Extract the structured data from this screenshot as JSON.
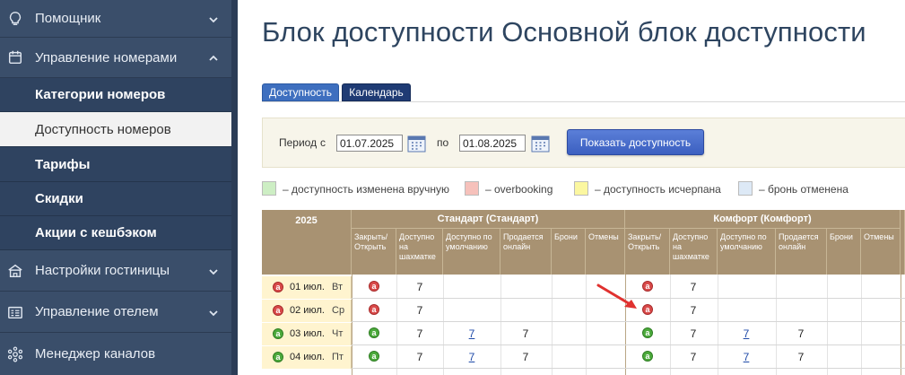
{
  "sidebar": {
    "items": [
      {
        "label": "Помощник",
        "icon": "lightbulb-icon",
        "expanded": false
      },
      {
        "label": "Управление номерами",
        "icon": "calendar-icon",
        "expanded": true
      },
      {
        "label": "Настройки гостиницы",
        "icon": "building-icon",
        "expanded": false
      },
      {
        "label": "Управление отелем",
        "icon": "dashboard-icon",
        "expanded": false
      },
      {
        "label": "Менеджер каналов",
        "icon": "network-icon",
        "expanded": false
      }
    ],
    "subitems": [
      {
        "label": "Категории номеров",
        "active": false
      },
      {
        "label": "Доступность номеров",
        "active": true
      },
      {
        "label": "Тарифы",
        "active": false
      },
      {
        "label": "Скидки",
        "active": false
      },
      {
        "label": "Акции с кешбэком",
        "active": false
      }
    ]
  },
  "page": {
    "title": "Блок доступности Основной блок доступности"
  },
  "tabs": [
    {
      "label": "Доступность",
      "active": true
    },
    {
      "label": "Календарь",
      "active": false
    }
  ],
  "filter": {
    "period_label": "Период",
    "from_label": "с",
    "from_value": "01.07.2025",
    "to_label": "по",
    "to_value": "01.08.2025",
    "show_button": "Показать доступность"
  },
  "legend": [
    {
      "color": "#cdeec4",
      "text": "– доступность изменена вручную"
    },
    {
      "color": "#f6c1bb",
      "text": "– overbooking"
    },
    {
      "color": "#fbf7a0",
      "text": "– доступность исчерпана"
    },
    {
      "color": "#dde9f6",
      "text": "– бронь отменена"
    }
  ],
  "grid": {
    "year": "2025",
    "groups": [
      "Стандарт (Стандарт)",
      "Комфорт (Комфорт)"
    ],
    "columns": [
      "Закрыть/ Открыть",
      "Доступно на шахматке",
      "Доступно по умолчанию",
      "Продается онлайн",
      "Брони",
      "Отмены"
    ],
    "rows": [
      {
        "status": "a",
        "status_color": "red",
        "day": "01 июл.",
        "weekday": "Вт",
        "standard": {
          "toggle": "a",
          "toggle_color": "red",
          "avail": "7",
          "default": "",
          "online": "",
          "bookings": "",
          "cancels": ""
        },
        "comfort": {
          "toggle": "a",
          "toggle_color": "red",
          "avail": "7",
          "default": "",
          "online": "",
          "bookings": "",
          "cancels": ""
        }
      },
      {
        "status": "a",
        "status_color": "red",
        "day": "02 июл.",
        "weekday": "Ср",
        "standard": {
          "toggle": "a",
          "toggle_color": "red",
          "avail": "7",
          "default": "",
          "online": "",
          "bookings": "",
          "cancels": ""
        },
        "comfort": {
          "toggle": "a",
          "toggle_color": "red",
          "avail": "7",
          "default": "",
          "online": "",
          "bookings": "",
          "cancels": ""
        }
      },
      {
        "status": "a",
        "status_color": "green",
        "day": "03 июл.",
        "weekday": "Чт",
        "standard": {
          "toggle": "a",
          "toggle_color": "green",
          "avail": "7",
          "default": "7",
          "online": "7",
          "bookings": "",
          "cancels": ""
        },
        "comfort": {
          "toggle": "a",
          "toggle_color": "green",
          "avail": "7",
          "default": "7",
          "online": "7",
          "bookings": "",
          "cancels": ""
        }
      },
      {
        "status": "a",
        "status_color": "green",
        "day": "04 июл.",
        "weekday": "Пт",
        "standard": {
          "toggle": "a",
          "toggle_color": "green",
          "avail": "7",
          "default": "7",
          "online": "7",
          "bookings": "",
          "cancels": ""
        },
        "comfort": {
          "toggle": "a",
          "toggle_color": "green",
          "avail": "7",
          "default": "7",
          "online": "7",
          "bookings": "",
          "cancels": ""
        }
      }
    ]
  }
}
